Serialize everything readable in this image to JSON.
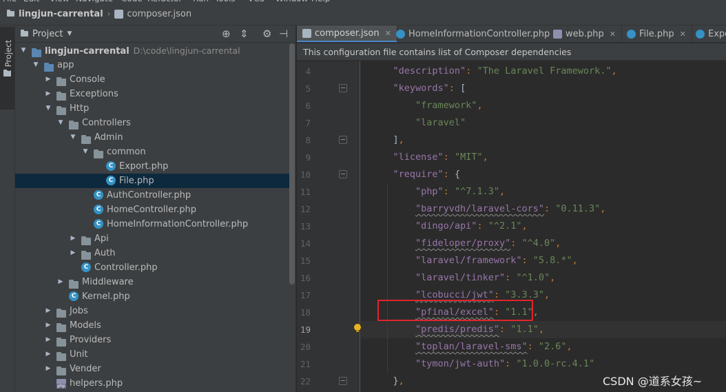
{
  "menu": [
    "File",
    "Edit",
    "View",
    "Navigate",
    "Code",
    "Refactor",
    "Run",
    "Tools",
    "VCS",
    "Window",
    "Help"
  ],
  "breadcrumb": {
    "project": "lingjun-carrental",
    "file": "composer.json"
  },
  "tool_strip": {
    "project_tab": "1: Project"
  },
  "project_panel": {
    "title": "Project",
    "tree": [
      {
        "label": "lingjun-carrental",
        "path": "D:\\code\\lingjun-carrental",
        "type": "module",
        "depth": 0,
        "expanded": true
      },
      {
        "label": "app",
        "type": "module",
        "depth": 1,
        "expanded": true
      },
      {
        "label": "Console",
        "type": "folder",
        "depth": 2,
        "expanded": false
      },
      {
        "label": "Exceptions",
        "type": "folder",
        "depth": 2,
        "expanded": false
      },
      {
        "label": "Http",
        "type": "folder",
        "depth": 2,
        "expanded": true
      },
      {
        "label": "Controllers",
        "type": "folder",
        "depth": 3,
        "expanded": true
      },
      {
        "label": "Admin",
        "type": "folder",
        "depth": 4,
        "expanded": true
      },
      {
        "label": "common",
        "type": "folder",
        "depth": 5,
        "expanded": true
      },
      {
        "label": "Export.php",
        "type": "class",
        "depth": 6
      },
      {
        "label": "File.php",
        "type": "class",
        "depth": 6,
        "selected": true
      },
      {
        "label": "AuthController.php",
        "type": "class",
        "depth": 5
      },
      {
        "label": "HomeController.php",
        "type": "class",
        "depth": 5
      },
      {
        "label": "HomeInformationController.php",
        "type": "class",
        "depth": 5
      },
      {
        "label": "Api",
        "type": "folder",
        "depth": 4,
        "expanded": false
      },
      {
        "label": "Auth",
        "type": "folder",
        "depth": 4,
        "expanded": false
      },
      {
        "label": "Controller.php",
        "type": "class",
        "depth": 4
      },
      {
        "label": "Middleware",
        "type": "folder",
        "depth": 3,
        "expanded": false
      },
      {
        "label": "Kernel.php",
        "type": "class",
        "depth": 3
      },
      {
        "label": "Jobs",
        "type": "folder",
        "depth": 2,
        "expanded": false
      },
      {
        "label": "Models",
        "type": "folder",
        "depth": 2,
        "expanded": false
      },
      {
        "label": "Providers",
        "type": "folder",
        "depth": 2,
        "expanded": false
      },
      {
        "label": "Unit",
        "type": "folder",
        "depth": 2,
        "expanded": false
      },
      {
        "label": "Vender",
        "type": "folder",
        "depth": 2,
        "expanded": false
      },
      {
        "label": "helpers.php",
        "type": "php",
        "depth": 2
      }
    ]
  },
  "editor": {
    "tabs": [
      {
        "label": "composer.json",
        "icon": "json-file-icon",
        "active": true
      },
      {
        "label": "HomeInformationController.php",
        "icon": "php-class-icon",
        "active": false
      },
      {
        "label": "web.php",
        "icon": "php-file-icon",
        "active": false
      },
      {
        "label": "File.php",
        "icon": "php-class-icon",
        "active": false
      },
      {
        "label": "Expo",
        "icon": "php-class-icon",
        "active": false
      }
    ],
    "banner": "This configuration file contains list of Composer dependencies",
    "current_line": 19,
    "lines": [
      {
        "n": 4,
        "indent": 1,
        "tokens": [
          [
            "key",
            "\"description\""
          ],
          [
            "punc",
            ": "
          ],
          [
            "str",
            "\"The Laravel Framework.\""
          ],
          [
            "punc",
            ","
          ]
        ]
      },
      {
        "n": 5,
        "indent": 1,
        "fold": true,
        "tokens": [
          [
            "key",
            "\"keywords\""
          ],
          [
            "punc",
            ": "
          ],
          [
            "br",
            "["
          ]
        ]
      },
      {
        "n": 6,
        "indent": 2,
        "tokens": [
          [
            "str",
            "\"framework\""
          ],
          [
            "punc",
            ","
          ]
        ]
      },
      {
        "n": 7,
        "indent": 2,
        "tokens": [
          [
            "str",
            "\"laravel\""
          ]
        ]
      },
      {
        "n": 8,
        "indent": 1,
        "fold": true,
        "tokens": [
          [
            "br",
            "]"
          ],
          [
            "punc",
            ","
          ]
        ]
      },
      {
        "n": 9,
        "indent": 1,
        "tokens": [
          [
            "key",
            "\"license\""
          ],
          [
            "punc",
            ": "
          ],
          [
            "str",
            "\"MIT\""
          ],
          [
            "punc",
            ","
          ]
        ]
      },
      {
        "n": 10,
        "indent": 1,
        "fold": true,
        "tokens": [
          [
            "key",
            "\"require\""
          ],
          [
            "punc",
            ": "
          ],
          [
            "br",
            "{"
          ]
        ]
      },
      {
        "n": 11,
        "indent": 2,
        "tokens": [
          [
            "key",
            "\"php\""
          ],
          [
            "punc",
            ": "
          ],
          [
            "str",
            "\"^7.1.3\""
          ],
          [
            "punc",
            ","
          ]
        ]
      },
      {
        "n": 12,
        "indent": 2,
        "tokens": [
          [
            "key",
            "\"barryvdh/laravel-cors\""
          ],
          [
            "punc",
            ": "
          ],
          [
            "str",
            "\"0.11.3\""
          ],
          [
            "punc",
            ","
          ]
        ]
      },
      {
        "n": 13,
        "indent": 2,
        "tokens": [
          [
            "key",
            "\"dingo/api\""
          ],
          [
            "punc",
            ": "
          ],
          [
            "str",
            "\"^2.1\""
          ],
          [
            "punc",
            ","
          ]
        ]
      },
      {
        "n": 14,
        "indent": 2,
        "tokens": [
          [
            "key",
            "\"fideloper/proxy\""
          ],
          [
            "punc",
            ": "
          ],
          [
            "str",
            "\"^4.0\""
          ],
          [
            "punc",
            ","
          ]
        ]
      },
      {
        "n": 15,
        "indent": 2,
        "tokens": [
          [
            "key",
            "\"laravel/framework\""
          ],
          [
            "punc",
            ": "
          ],
          [
            "str",
            "\"5.8.*\""
          ],
          [
            "punc",
            ","
          ]
        ]
      },
      {
        "n": 16,
        "indent": 2,
        "tokens": [
          [
            "key",
            "\"laravel/tinker\""
          ],
          [
            "punc",
            ": "
          ],
          [
            "str",
            "\"^1.0\""
          ],
          [
            "punc",
            ","
          ]
        ]
      },
      {
        "n": 17,
        "indent": 2,
        "tokens": [
          [
            "key",
            "\"lcobucci/jwt\""
          ],
          [
            "punc",
            ": "
          ],
          [
            "str",
            "\"3.3.3\""
          ],
          [
            "punc",
            ","
          ]
        ]
      },
      {
        "n": 18,
        "indent": 2,
        "tokens": [
          [
            "key",
            "\"pfinal/excel\""
          ],
          [
            "punc",
            ": "
          ],
          [
            "str",
            "\"1.1\""
          ],
          [
            "punc",
            ","
          ]
        ]
      },
      {
        "n": 19,
        "indent": 2,
        "bulb": true,
        "tokens": [
          [
            "key",
            "\"predis/predis\""
          ],
          [
            "punc",
            ": "
          ],
          [
            "str",
            "\"1.1\""
          ],
          [
            "punc",
            ","
          ]
        ]
      },
      {
        "n": 20,
        "indent": 2,
        "tokens": [
          [
            "key",
            "\"toplan/laravel-sms\""
          ],
          [
            "punc",
            ": "
          ],
          [
            "str",
            "\"2.6\""
          ],
          [
            "punc",
            ","
          ]
        ]
      },
      {
        "n": 21,
        "indent": 2,
        "tokens": [
          [
            "key",
            "\"tymon/jwt-auth\""
          ],
          [
            "punc",
            ": "
          ],
          [
            "str",
            "\"1.0.0-rc.4.1\""
          ]
        ]
      },
      {
        "n": 22,
        "indent": 1,
        "fold": true,
        "tokens": [
          [
            "br",
            "}"
          ],
          [
            "punc",
            ","
          ]
        ]
      }
    ]
  },
  "watermark": "CSDN @道系女孩~"
}
